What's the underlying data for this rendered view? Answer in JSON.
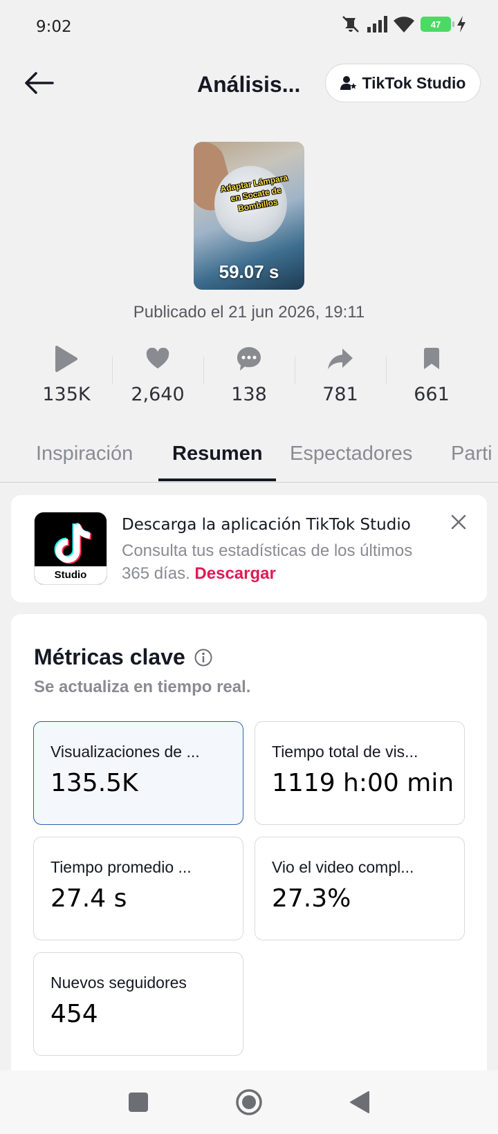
{
  "status_bar": {
    "time": "9:02",
    "battery": "47",
    "icons": [
      "mute-icon",
      "signal-icon",
      "wifi-icon",
      "battery-icon",
      "charging-icon"
    ]
  },
  "header": {
    "title": "Análisis...",
    "studio_button": "TikTok Studio"
  },
  "video": {
    "caption": "Adaptar Lámpara en Socate de Bombillos",
    "duration": "59.07 s",
    "published": "Publicado el 21 jun 2026, 19:11"
  },
  "stats": [
    {
      "icon": "play-icon",
      "value": "135K"
    },
    {
      "icon": "heart-icon",
      "value": "2,640"
    },
    {
      "icon": "comment-icon",
      "value": "138"
    },
    {
      "icon": "share-icon",
      "value": "781"
    },
    {
      "icon": "bookmark-icon",
      "value": "661"
    }
  ],
  "tabs": [
    {
      "label": "Inspiración",
      "active": false
    },
    {
      "label": "Resumen",
      "active": true
    },
    {
      "label": "Espectadores",
      "active": false
    },
    {
      "label": "Parti",
      "active": false
    }
  ],
  "banner": {
    "app_label": "Studio",
    "title": "Descarga la aplicación TikTok Studio",
    "text": "Consulta tus estadísticas de los últimos 365 días.",
    "link": "Descargar"
  },
  "metrics": {
    "title": "Métricas clave",
    "subtitle": "Se actualiza en tiempo real.",
    "tiles": [
      {
        "label": "Visualizaciones de ...",
        "value": "135.5K",
        "selected": true
      },
      {
        "label": "Tiempo total de vis...",
        "value": "1119 h:00 min",
        "selected": false
      },
      {
        "label": "Tiempo promedio ...",
        "value": "27.4 s",
        "selected": false
      },
      {
        "label": "Vio el video compl...",
        "value": "27.3%",
        "selected": false
      },
      {
        "label": "Nuevos seguidores",
        "value": "454",
        "selected": false
      }
    ]
  },
  "colors": {
    "accent_link": "#e01a55",
    "selected_border": "#2b5fa8",
    "battery": "#4cd964"
  }
}
